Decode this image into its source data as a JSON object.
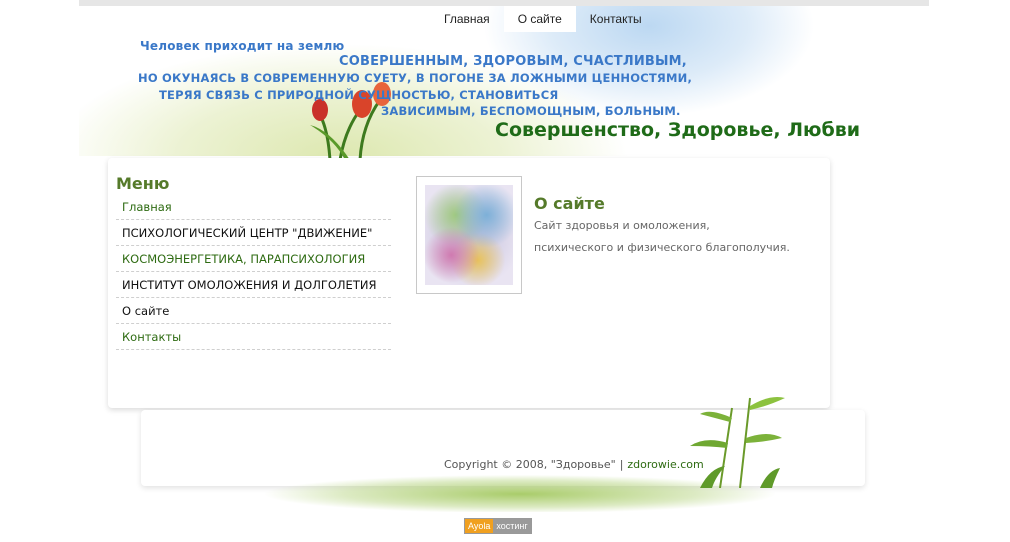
{
  "nav": {
    "items": [
      {
        "label": "Главная"
      },
      {
        "label": "О сайте"
      },
      {
        "label": "Контакты"
      }
    ]
  },
  "header": {
    "slogan": [
      "Человек приходит на землю",
      "СОВЕРШЕННЫМ, ЗДОРОВЫМ, СЧАСТЛИВЫМ,",
      "НО ОКУНАЯСЬ В СОВРЕМЕННУЮ СУЕТУ, В ПОГОНЕ ЗА ЛОЖНЫМИ ЦЕННОСТЯМИ,",
      "ТЕРЯЯ СВЯЗЬ С ПРИРОДНОЙ СУЩНОСТЬЮ, СТАНОВИТЬСЯ",
      "ЗАВИСИМЫМ, БЕСПОМОЩНЫМ, БОЛЬНЫМ."
    ],
    "title": "Совершенство, Здоровье, Любви"
  },
  "menu": {
    "title": "Меню",
    "items": [
      {
        "label": "Главная"
      },
      {
        "label": "ПСИХОЛОГИЧЕСКИЙ ЦЕНТР \"ДВИЖЕНИЕ\""
      },
      {
        "label": "КОСМОЭНЕРГЕТИКА, ПАРАПСИХОЛОГИЯ"
      },
      {
        "label": "ИНСТИТУТ ОМОЛОЖЕНИЯ И ДОЛГОЛЕТИЯ"
      },
      {
        "label": "О сайте"
      },
      {
        "label": "Контакты"
      }
    ]
  },
  "content": {
    "title": "О сайте",
    "paragraphs": [
      "Сайт здоровья и омоложения,",
      "психического и физического благополучия."
    ]
  },
  "footer": {
    "copyright": "Copyright © 2008, \"Здоровье\"",
    "separator": "|",
    "link": "zdorowie.com"
  },
  "badge": {
    "left": "Ayola",
    "right": "хостинг"
  },
  "colors": {
    "accent_green": "#2e6b12",
    "slogan_blue": "#3a78c8",
    "heading_olive": "#557a2a"
  }
}
